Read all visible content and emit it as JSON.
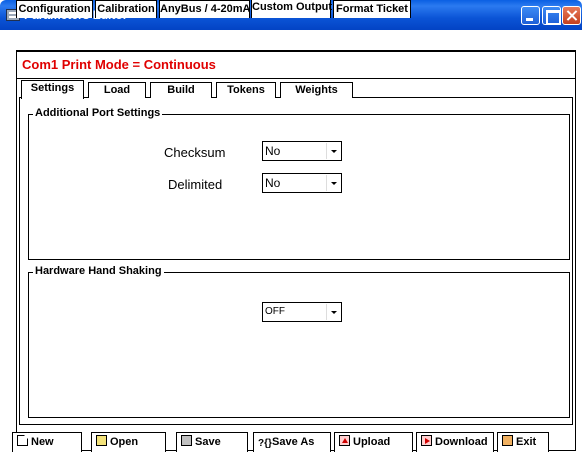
{
  "window": {
    "title": "Parameters Editor"
  },
  "top_tabs": [
    {
      "label": "Configuration",
      "active": false
    },
    {
      "label": "Calibration",
      "active": false
    },
    {
      "label": "AnyBus / 4-20mA",
      "active": false
    },
    {
      "label": "Custom Output",
      "active": true
    },
    {
      "label": "Format Ticket",
      "active": false
    }
  ],
  "mode_line": "Com1 Print Mode = Continuous",
  "sub_tabs": [
    {
      "label": "Settings",
      "active": true
    },
    {
      "label": "Load",
      "active": false
    },
    {
      "label": "Build",
      "active": false
    },
    {
      "label": "Tokens",
      "active": false
    },
    {
      "label": "Weights",
      "active": false
    }
  ],
  "additional_port": {
    "title": "Additional Port Settings",
    "checksum_label": "Checksum",
    "checksum_value": "No",
    "delimited_label": "Delimited",
    "delimited_value": "No"
  },
  "handshaking": {
    "title": "Hardware Hand Shaking",
    "value": "OFF"
  },
  "buttons": {
    "new": "New",
    "open": "Open",
    "save": "Save",
    "save_as": "Save As",
    "upload": "Upload",
    "download": "Download",
    "exit": "Exit"
  },
  "icons": {
    "save_as_glyph": "?{}"
  },
  "colors": {
    "titlebar": "#0b54d6",
    "mode_text": "#e00000"
  }
}
